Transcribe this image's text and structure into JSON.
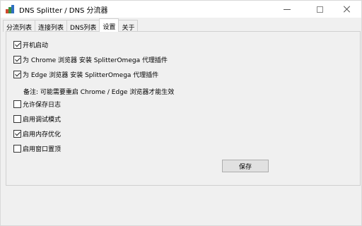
{
  "window": {
    "title": "DNS Splitter / DNS 分流器"
  },
  "tabs": [
    {
      "label": "分流列表"
    },
    {
      "label": "连接列表"
    },
    {
      "label": "DNS列表"
    },
    {
      "label": "设置"
    },
    {
      "label": "关于"
    }
  ],
  "active_tab": "设置",
  "settings": {
    "autostart": {
      "label": "开机启动",
      "checked": true
    },
    "chrome_plugin": {
      "label": "为 Chrome 浏览器 安装 SplitterOmega 代理插件",
      "checked": true
    },
    "edge_plugin": {
      "label": "为 Edge 浏览器 安装 SplitterOmega 代理插件",
      "checked": true
    },
    "note": "备注: 可能需要重启 Chrome / Edge 浏览器才能生效",
    "save_log": {
      "label": "允许保存日志",
      "checked": false
    },
    "debug_mode": {
      "label": "启用调试模式",
      "checked": false
    },
    "memory_opt": {
      "label": "启用内存优化",
      "checked": true
    },
    "always_on_top": {
      "label": "启用窗口置顶",
      "checked": false
    }
  },
  "buttons": {
    "save_label": "保存"
  },
  "icons": {
    "app": "app-icon",
    "minimize": "minimize-icon",
    "maximize": "maximize-icon",
    "close": "close-icon"
  }
}
